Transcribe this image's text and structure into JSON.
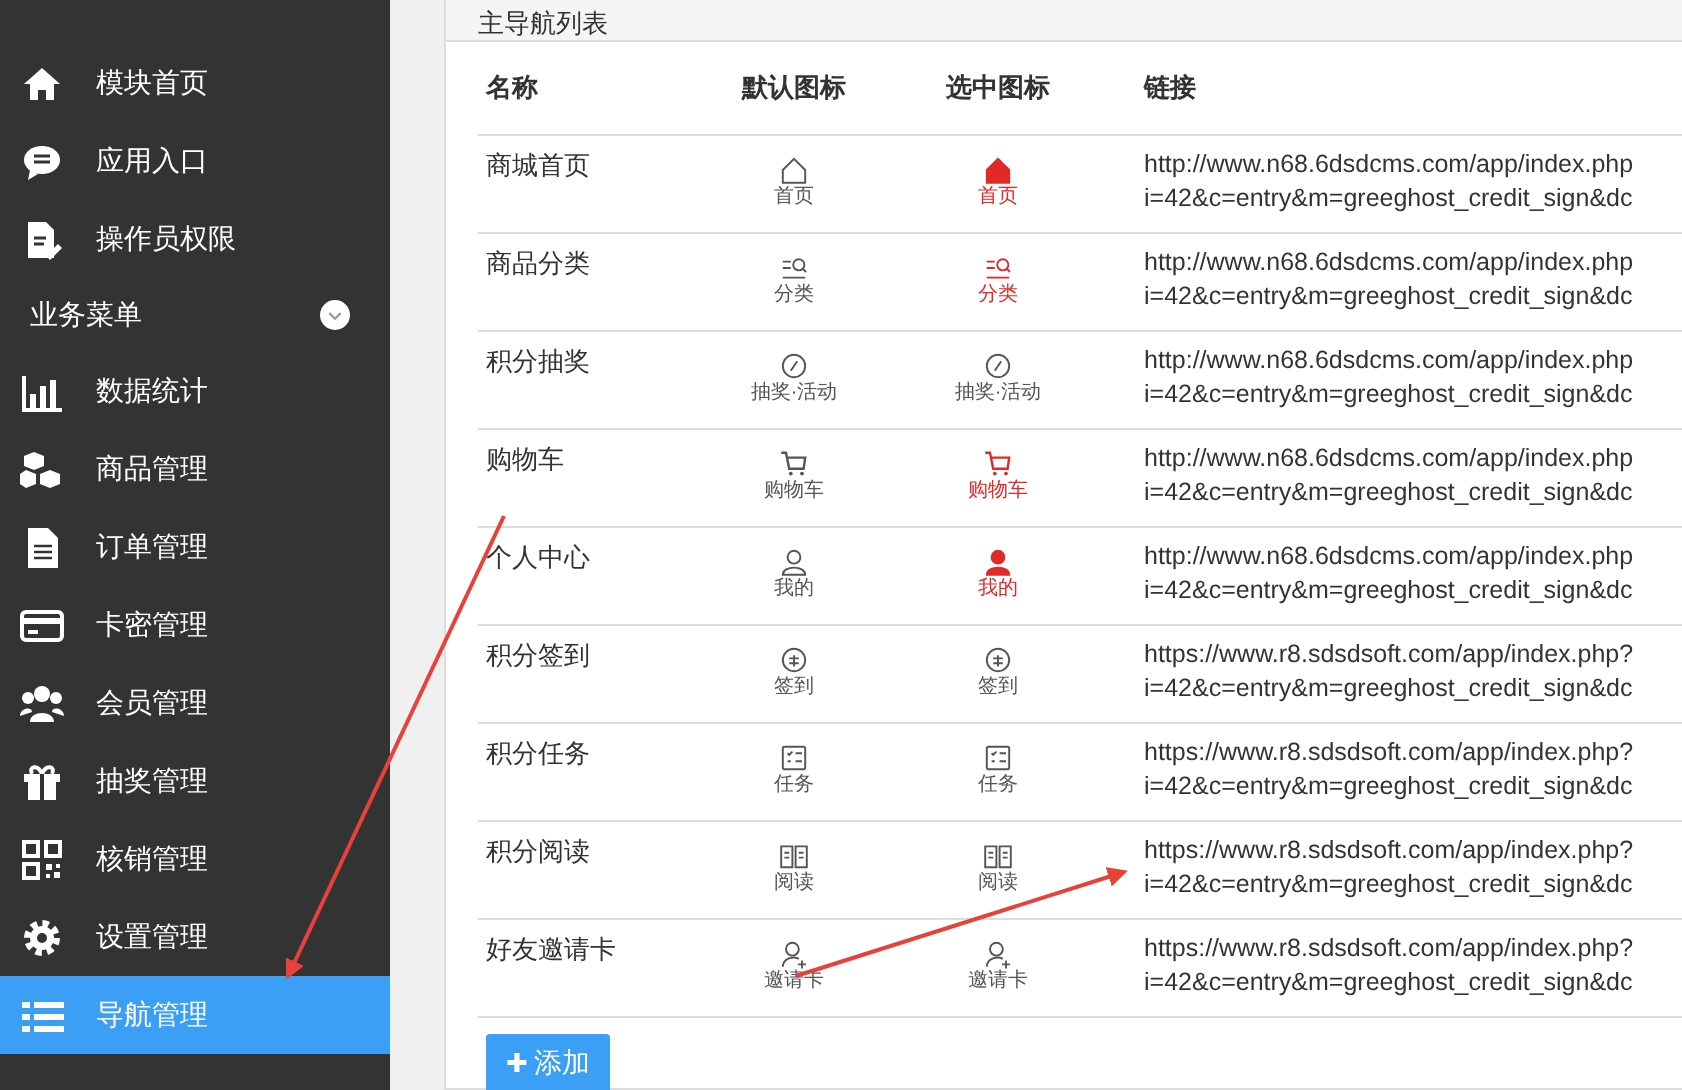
{
  "sidebar": {
    "items": [
      {
        "label": "模块首页",
        "selected": false
      },
      {
        "label": "应用入口",
        "selected": false
      },
      {
        "label": "操作员权限",
        "selected": false
      }
    ],
    "section": {
      "label": "业务菜单",
      "expanded": true
    },
    "section_items": [
      {
        "label": "数据统计",
        "selected": false
      },
      {
        "label": "商品管理",
        "selected": false
      },
      {
        "label": "订单管理",
        "selected": false
      },
      {
        "label": "卡密管理",
        "selected": false
      },
      {
        "label": "会员管理",
        "selected": false
      },
      {
        "label": "抽奖管理",
        "selected": false
      },
      {
        "label": "核销管理",
        "selected": false
      },
      {
        "label": "设置管理",
        "selected": false
      },
      {
        "label": "导航管理",
        "selected": true
      }
    ]
  },
  "panel": {
    "title": "主导航列表",
    "table": {
      "columns": [
        "名称",
        "默认图标",
        "选中图标",
        "链接"
      ],
      "rows": [
        {
          "name": "商城首页",
          "default_caption": "首页",
          "selected_caption": "首页",
          "selected_red": true,
          "link": [
            "http://www.n68.6dsdcms.com/app/index.php",
            "i=42&c=entry&m=greeghost_credit_sign&dc"
          ]
        },
        {
          "name": "商品分类",
          "default_caption": "分类",
          "selected_caption": "分类",
          "selected_red": true,
          "link": [
            "http://www.n68.6dsdcms.com/app/index.php",
            "i=42&c=entry&m=greeghost_credit_sign&dc"
          ]
        },
        {
          "name": "积分抽奖",
          "default_caption": "抽奖·活动",
          "selected_caption": "抽奖·活动",
          "selected_red": false,
          "link": [
            "http://www.n68.6dsdcms.com/app/index.php",
            "i=42&c=entry&m=greeghost_credit_sign&dc"
          ]
        },
        {
          "name": "购物车",
          "default_caption": "购物车",
          "selected_caption": "购物车",
          "selected_red": true,
          "link": [
            "http://www.n68.6dsdcms.com/app/index.php",
            "i=42&c=entry&m=greeghost_credit_sign&dc"
          ]
        },
        {
          "name": "个人中心",
          "default_caption": "我的",
          "selected_caption": "我的",
          "selected_red": true,
          "link": [
            "http://www.n68.6dsdcms.com/app/index.php",
            "i=42&c=entry&m=greeghost_credit_sign&dc"
          ]
        },
        {
          "name": "积分签到",
          "default_caption": "签到",
          "selected_caption": "签到",
          "selected_red": false,
          "link": [
            "https://www.r8.sdsdsoft.com/app/index.php?",
            "i=42&c=entry&m=greeghost_credit_sign&dc"
          ]
        },
        {
          "name": "积分任务",
          "default_caption": "任务",
          "selected_caption": "任务",
          "selected_red": false,
          "link": [
            "https://www.r8.sdsdsoft.com/app/index.php?",
            "i=42&c=entry&m=greeghost_credit_sign&dc"
          ]
        },
        {
          "name": "积分阅读",
          "default_caption": "阅读",
          "selected_caption": "阅读",
          "selected_red": false,
          "link": [
            "https://www.r8.sdsdsoft.com/app/index.php?",
            "i=42&c=entry&m=greeghost_credit_sign&dc"
          ]
        },
        {
          "name": "好友邀请卡",
          "default_caption": "邀请卡",
          "selected_caption": "邀请卡",
          "selected_red": false,
          "link": [
            "https://www.r8.sdsdsoft.com/app/index.php?",
            "i=42&c=entry&m=greeghost_credit_sign&dc"
          ]
        }
      ]
    },
    "add_button": {
      "icon": "✚",
      "label": "添加"
    }
  }
}
